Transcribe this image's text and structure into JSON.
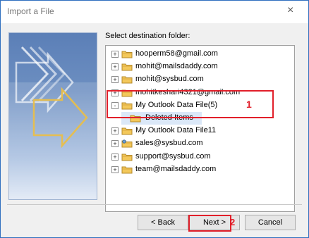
{
  "window": {
    "title": "Import a File",
    "close_glyph": "×"
  },
  "label": "Select destination folder:",
  "tree": {
    "items": [
      {
        "label": "hooperm58@gmail.com",
        "indent": 0,
        "expander": "+",
        "icon": "folder-icon"
      },
      {
        "label": "mohit@mailsdaddy.com",
        "indent": 0,
        "expander": "+",
        "icon": "folder-icon"
      },
      {
        "label": "mohit@sysbud.com",
        "indent": 0,
        "expander": "+",
        "icon": "folder-icon"
      },
      {
        "label": "mohitkeshari4321@gmail.com",
        "indent": 0,
        "expander": "+",
        "icon": "folder-icon"
      },
      {
        "label": "My Outlook Data File(5)",
        "indent": 0,
        "expander": "-",
        "icon": "folder-open-icon"
      },
      {
        "label": "Deleted Items",
        "indent": 1,
        "expander": "",
        "icon": "folder-icon",
        "selected": true
      },
      {
        "label": "My Outlook Data File11",
        "indent": 0,
        "expander": "+",
        "icon": "folder-icon"
      },
      {
        "label": "sales@sysbud.com",
        "indent": 0,
        "expander": "+",
        "icon": "shared-folder-icon"
      },
      {
        "label": "support@sysbud.com",
        "indent": 0,
        "expander": "+",
        "icon": "folder-icon"
      },
      {
        "label": "team@mailsdaddy.com",
        "indent": 0,
        "expander": "+",
        "icon": "folder-icon"
      }
    ]
  },
  "buttons": {
    "back": "< Back",
    "next": "Next >",
    "cancel": "Cancel"
  },
  "annotations": {
    "marker1": "1",
    "marker2": "2"
  },
  "colors": {
    "annotation_red": "#e11f2a",
    "selection_blue": "#dbe8f8"
  }
}
